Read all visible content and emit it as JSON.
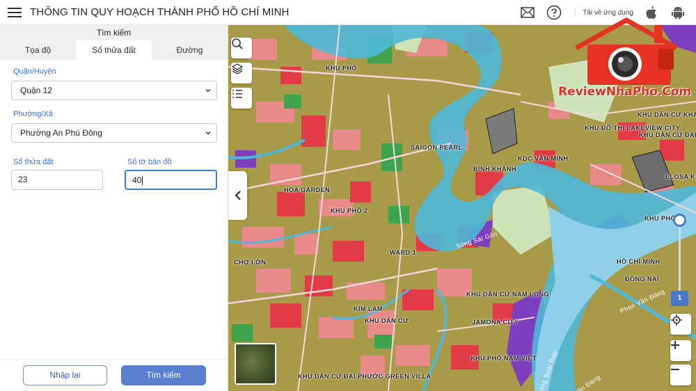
{
  "header": {
    "title": "THÔNG TIN QUY HOẠCH THÀNH PHỐ HỒ CHÍ MINH",
    "download_label": "Tải về ứng dụng"
  },
  "search_panel": {
    "title": "Tìm kiếm",
    "tabs": [
      {
        "label": "Tọa độ",
        "active": false
      },
      {
        "label": "Số thửa đất",
        "active": true
      },
      {
        "label": "Đường",
        "active": false
      }
    ],
    "district": {
      "label": "Quận/Huyện",
      "value": "Quận 12"
    },
    "ward": {
      "label": "Phường/Xã",
      "value": "Phường An Phú Đông"
    },
    "parcel_number": {
      "label": "Số thửa đất",
      "value": "23"
    },
    "map_sheet_number": {
      "label": "Số tờ bản đồ",
      "value": "40"
    },
    "reset_label": "Nhập lại",
    "search_label": "Tìm kiếm"
  },
  "map": {
    "zoom_level": "1",
    "labels": [
      "KHU PHỐ",
      "SAIGON PEARL",
      "KHU PHỐ 2",
      "KDC VĂN MINH",
      "BÌNH KHÁNH",
      "WARD 1",
      "KHU ĐÔ THỊ LAKEVIEW CITY",
      "KHU DÂN CƯ KHANG AN",
      "KHU DÂN CƯ ĐẠI HỌC BÁCH KHOA",
      "ELOSA KHANG ĐIỀN",
      "KHU PHỐ",
      "HỒ CHÍ MINH",
      "ĐỒNG NAI",
      "HOA GARDEN",
      "KHU DÂN CƯ NAM LONG",
      "JAMONA CITY",
      "KHU DÂN CƯ",
      "KHU PHỐ NAM VIỆT",
      "KHU DÂN CƯ ĐẠI PHƯỚC GREEN VILLA",
      "CHỢ LỚN",
      "KIM LAM",
      "Sông Sài Gòn",
      "Phan Văn Đáng",
      "Sông Soài Rạp",
      "Phan Văn Đáng"
    ]
  },
  "watermark": {
    "text": "ReviewNhaPho.Com"
  },
  "colors": {
    "accent": "#4a78c9",
    "river": "#4fb8d8",
    "land": "#a79a48",
    "residential": "#e88a8a",
    "commercial": "#e23b45",
    "green": "#3fa24c",
    "industrial": "#7e3fbf"
  }
}
